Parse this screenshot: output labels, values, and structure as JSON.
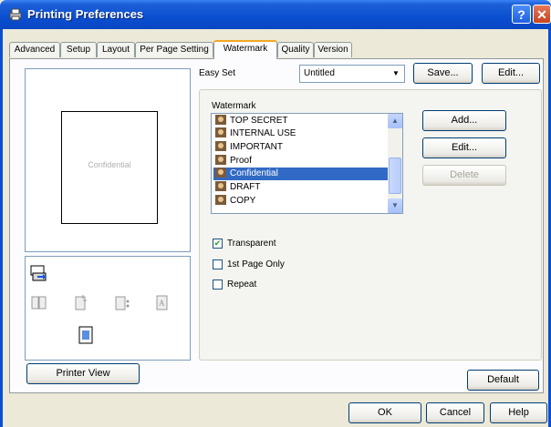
{
  "window": {
    "title": "Printing Preferences",
    "help_label": "?",
    "close_label": "✕",
    "icon": "printer-icon"
  },
  "tabs": [
    {
      "label": "Advanced"
    },
    {
      "label": "Setup"
    },
    {
      "label": "Layout"
    },
    {
      "label": "Per Page Setting"
    },
    {
      "label": "Watermark"
    },
    {
      "label": "Quality"
    },
    {
      "label": "Version"
    }
  ],
  "active_tab": "Watermark",
  "preview": {
    "page_watermark": "Confidential",
    "printer_view_label": "Printer View"
  },
  "easy_set": {
    "label": "Easy Set",
    "value": "Untitled",
    "save_label": "Save...",
    "edit_label": "Edit..."
  },
  "watermark": {
    "label": "Watermark",
    "items": [
      {
        "label": "TOP SECRET"
      },
      {
        "label": "INTERNAL USE"
      },
      {
        "label": "IMPORTANT"
      },
      {
        "label": "Proof"
      },
      {
        "label": "Confidential"
      },
      {
        "label": "DRAFT"
      },
      {
        "label": "COPY"
      }
    ],
    "selected": "Confidential",
    "add_label": "Add...",
    "edit_label": "Edit...",
    "delete_label": "Delete"
  },
  "options": {
    "transparent": {
      "label": "Transparent",
      "checked": true
    },
    "first_page_only": {
      "label": "1st Page Only",
      "checked": false
    },
    "repeat": {
      "label": "Repeat",
      "checked": false
    }
  },
  "default_label": "Default",
  "footer": {
    "ok_label": "OK",
    "cancel_label": "Cancel",
    "help_label": "Help"
  },
  "colors": {
    "titlebar": "#0a4fd0",
    "selection": "#316ac5",
    "face": "#ece9d8"
  }
}
